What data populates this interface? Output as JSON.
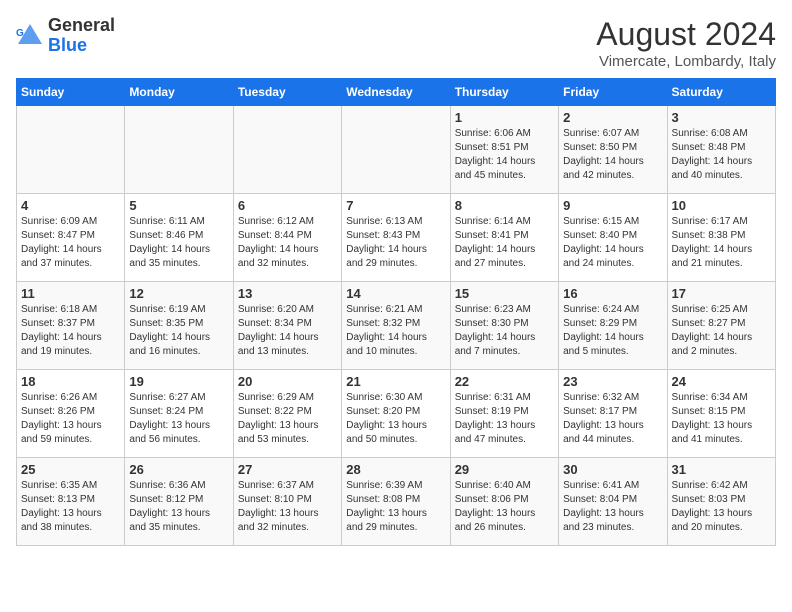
{
  "logo": {
    "name": "General",
    "name2": "Blue"
  },
  "title": "August 2024",
  "subtitle": "Vimercate, Lombardy, Italy",
  "days_of_week": [
    "Sunday",
    "Monday",
    "Tuesday",
    "Wednesday",
    "Thursday",
    "Friday",
    "Saturday"
  ],
  "weeks": [
    [
      {
        "day": "",
        "info": ""
      },
      {
        "day": "",
        "info": ""
      },
      {
        "day": "",
        "info": ""
      },
      {
        "day": "",
        "info": ""
      },
      {
        "day": "1",
        "info": "Sunrise: 6:06 AM\nSunset: 8:51 PM\nDaylight: 14 hours\nand 45 minutes."
      },
      {
        "day": "2",
        "info": "Sunrise: 6:07 AM\nSunset: 8:50 PM\nDaylight: 14 hours\nand 42 minutes."
      },
      {
        "day": "3",
        "info": "Sunrise: 6:08 AM\nSunset: 8:48 PM\nDaylight: 14 hours\nand 40 minutes."
      }
    ],
    [
      {
        "day": "4",
        "info": "Sunrise: 6:09 AM\nSunset: 8:47 PM\nDaylight: 14 hours\nand 37 minutes."
      },
      {
        "day": "5",
        "info": "Sunrise: 6:11 AM\nSunset: 8:46 PM\nDaylight: 14 hours\nand 35 minutes."
      },
      {
        "day": "6",
        "info": "Sunrise: 6:12 AM\nSunset: 8:44 PM\nDaylight: 14 hours\nand 32 minutes."
      },
      {
        "day": "7",
        "info": "Sunrise: 6:13 AM\nSunset: 8:43 PM\nDaylight: 14 hours\nand 29 minutes."
      },
      {
        "day": "8",
        "info": "Sunrise: 6:14 AM\nSunset: 8:41 PM\nDaylight: 14 hours\nand 27 minutes."
      },
      {
        "day": "9",
        "info": "Sunrise: 6:15 AM\nSunset: 8:40 PM\nDaylight: 14 hours\nand 24 minutes."
      },
      {
        "day": "10",
        "info": "Sunrise: 6:17 AM\nSunset: 8:38 PM\nDaylight: 14 hours\nand 21 minutes."
      }
    ],
    [
      {
        "day": "11",
        "info": "Sunrise: 6:18 AM\nSunset: 8:37 PM\nDaylight: 14 hours\nand 19 minutes."
      },
      {
        "day": "12",
        "info": "Sunrise: 6:19 AM\nSunset: 8:35 PM\nDaylight: 14 hours\nand 16 minutes."
      },
      {
        "day": "13",
        "info": "Sunrise: 6:20 AM\nSunset: 8:34 PM\nDaylight: 14 hours\nand 13 minutes."
      },
      {
        "day": "14",
        "info": "Sunrise: 6:21 AM\nSunset: 8:32 PM\nDaylight: 14 hours\nand 10 minutes."
      },
      {
        "day": "15",
        "info": "Sunrise: 6:23 AM\nSunset: 8:30 PM\nDaylight: 14 hours\nand 7 minutes."
      },
      {
        "day": "16",
        "info": "Sunrise: 6:24 AM\nSunset: 8:29 PM\nDaylight: 14 hours\nand 5 minutes."
      },
      {
        "day": "17",
        "info": "Sunrise: 6:25 AM\nSunset: 8:27 PM\nDaylight: 14 hours\nand 2 minutes."
      }
    ],
    [
      {
        "day": "18",
        "info": "Sunrise: 6:26 AM\nSunset: 8:26 PM\nDaylight: 13 hours\nand 59 minutes."
      },
      {
        "day": "19",
        "info": "Sunrise: 6:27 AM\nSunset: 8:24 PM\nDaylight: 13 hours\nand 56 minutes."
      },
      {
        "day": "20",
        "info": "Sunrise: 6:29 AM\nSunset: 8:22 PM\nDaylight: 13 hours\nand 53 minutes."
      },
      {
        "day": "21",
        "info": "Sunrise: 6:30 AM\nSunset: 8:20 PM\nDaylight: 13 hours\nand 50 minutes."
      },
      {
        "day": "22",
        "info": "Sunrise: 6:31 AM\nSunset: 8:19 PM\nDaylight: 13 hours\nand 47 minutes."
      },
      {
        "day": "23",
        "info": "Sunrise: 6:32 AM\nSunset: 8:17 PM\nDaylight: 13 hours\nand 44 minutes."
      },
      {
        "day": "24",
        "info": "Sunrise: 6:34 AM\nSunset: 8:15 PM\nDaylight: 13 hours\nand 41 minutes."
      }
    ],
    [
      {
        "day": "25",
        "info": "Sunrise: 6:35 AM\nSunset: 8:13 PM\nDaylight: 13 hours\nand 38 minutes."
      },
      {
        "day": "26",
        "info": "Sunrise: 6:36 AM\nSunset: 8:12 PM\nDaylight: 13 hours\nand 35 minutes."
      },
      {
        "day": "27",
        "info": "Sunrise: 6:37 AM\nSunset: 8:10 PM\nDaylight: 13 hours\nand 32 minutes."
      },
      {
        "day": "28",
        "info": "Sunrise: 6:39 AM\nSunset: 8:08 PM\nDaylight: 13 hours\nand 29 minutes."
      },
      {
        "day": "29",
        "info": "Sunrise: 6:40 AM\nSunset: 8:06 PM\nDaylight: 13 hours\nand 26 minutes."
      },
      {
        "day": "30",
        "info": "Sunrise: 6:41 AM\nSunset: 8:04 PM\nDaylight: 13 hours\nand 23 minutes."
      },
      {
        "day": "31",
        "info": "Sunrise: 6:42 AM\nSunset: 8:03 PM\nDaylight: 13 hours\nand 20 minutes."
      }
    ]
  ]
}
